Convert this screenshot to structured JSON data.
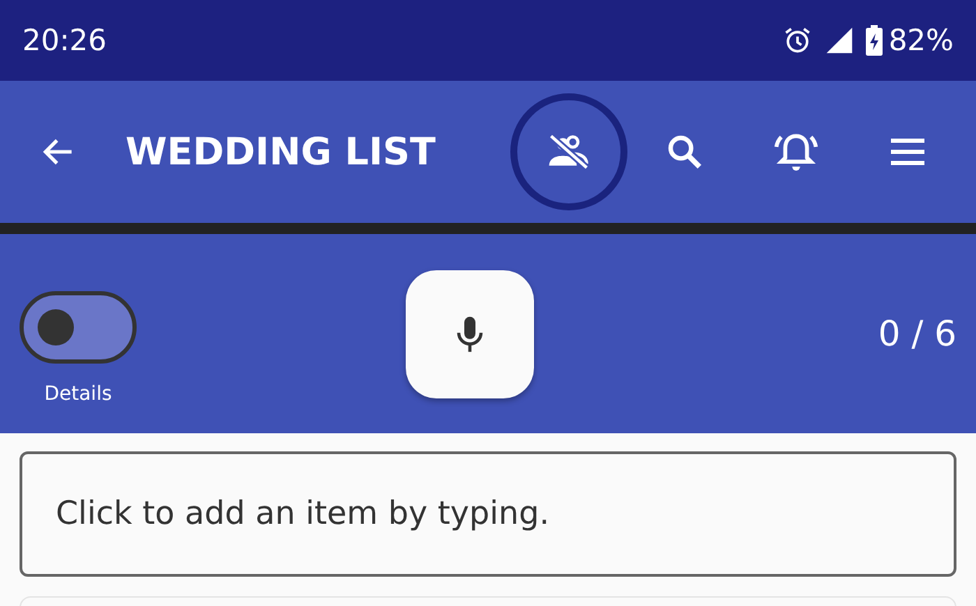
{
  "status_bar": {
    "time": "20:26",
    "battery": "82%"
  },
  "app_bar": {
    "title": "WEDDING LIST",
    "actions": [
      {
        "kind": "people-off",
        "highlighted": true
      },
      {
        "kind": "search",
        "highlighted": false
      },
      {
        "kind": "alarm",
        "highlighted": false
      },
      {
        "kind": "menu",
        "highlighted": false
      }
    ]
  },
  "controls": {
    "details_toggle": {
      "label": "Details",
      "on": false
    },
    "counter": "0 / 6"
  },
  "add_item": {
    "placeholder": "Click to add an item by typing."
  }
}
